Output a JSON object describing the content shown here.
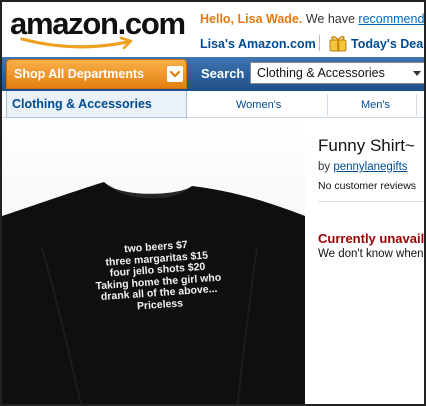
{
  "header": {
    "logo_text": "amazon.com",
    "greeting_hello": "Hello, Lisa Wade.",
    "greeting_rest": " We have ",
    "greeting_link": "recommendations",
    "your_store": "Lisa's Amazon.com",
    "deals": "Today's Deals"
  },
  "nav": {
    "shop_all": "Shop All Departments",
    "search_label": "Search",
    "search_category": "Clothing & Accessories"
  },
  "subnav": {
    "active": "Clothing & Accessories",
    "links": [
      "Women's",
      "Men's"
    ]
  },
  "product": {
    "title": "Funny Shirt~",
    "by_prefix": "by ",
    "seller": "pennylanegifts",
    "reviews": "No customer reviews",
    "availability": "Currently unavailable",
    "availability_note": "We don't know when",
    "shirt_lines": [
      "two beers $7",
      "three margaritas $15",
      "four jello shots $20",
      "Taking home the girl who",
      "drank all of the above...",
      "Priceless"
    ]
  },
  "colors": {
    "nav_blue": "#2d5d95",
    "shop_orange": "#e5800f",
    "link_blue": "#004b91",
    "unavailable_red": "#990000"
  }
}
